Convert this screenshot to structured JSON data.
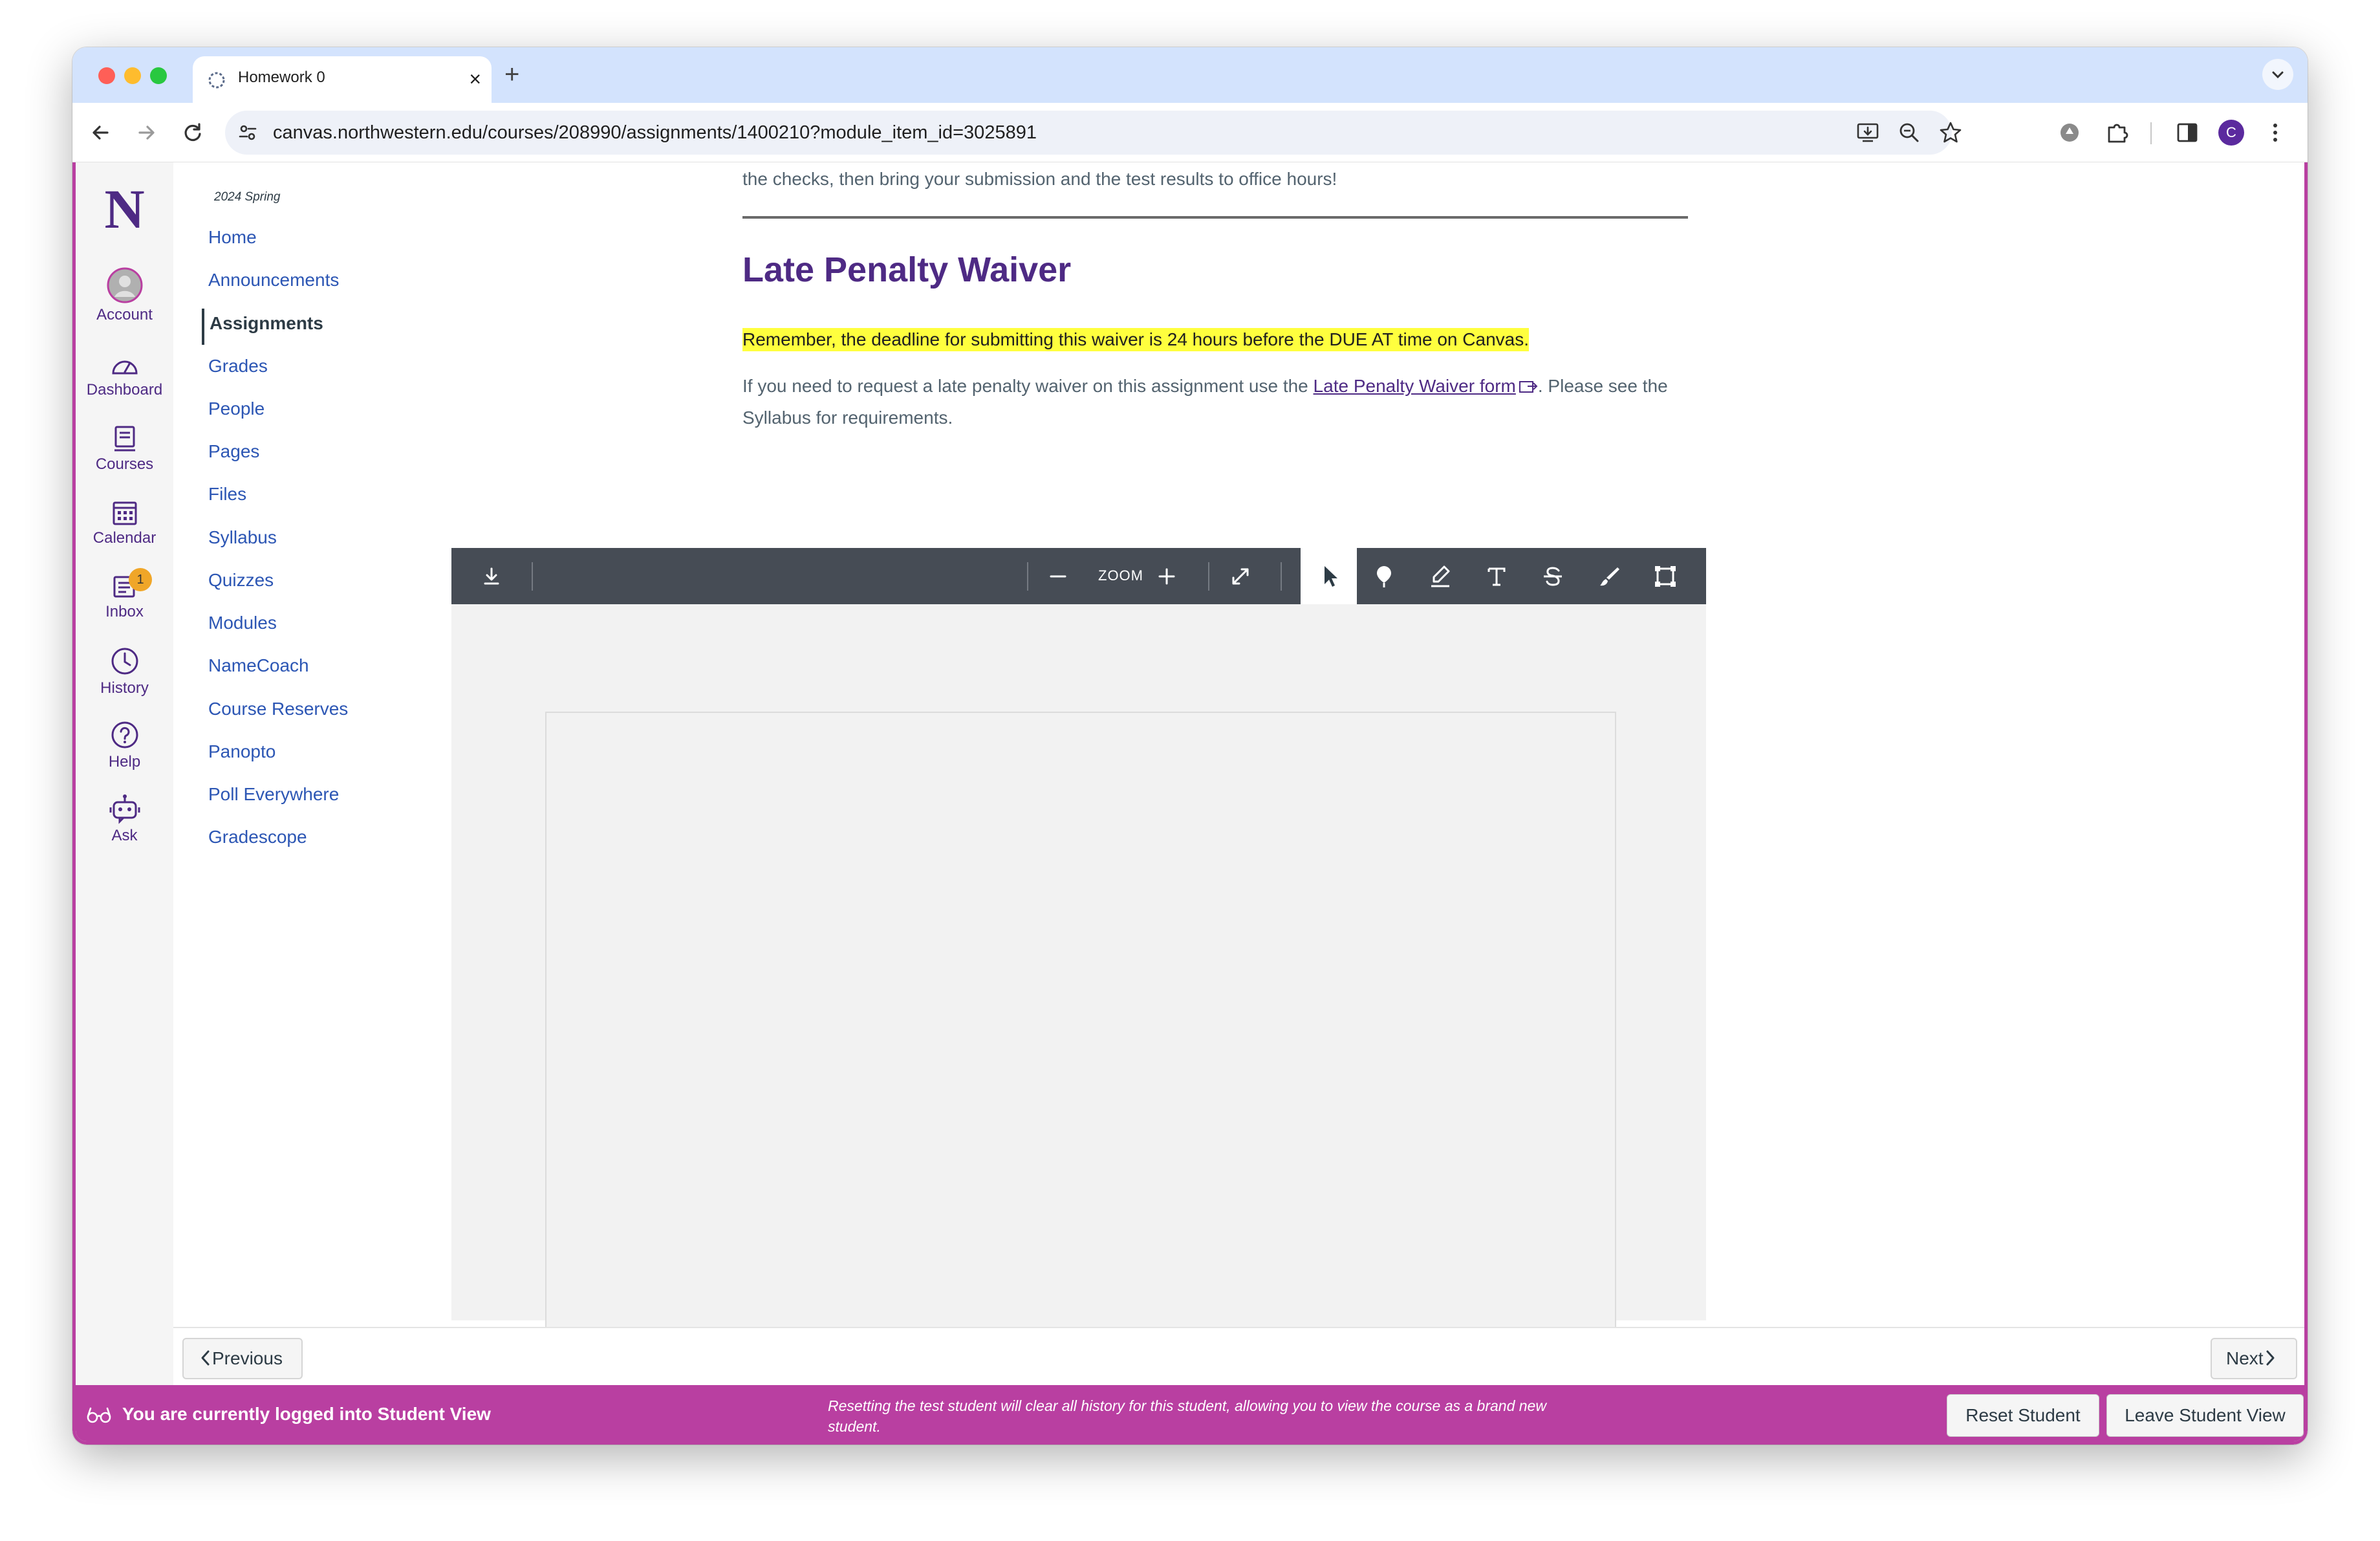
{
  "browser": {
    "tab_title": "Homework 0",
    "new_tab_symbol": "+",
    "close_symbol": "×",
    "url": "canvas.northwestern.edu/courses/208990/assignments/1400210?module_item_id=3025891",
    "profile_initial": "C"
  },
  "global_nav": {
    "logo": "N",
    "items": [
      {
        "label": "Account",
        "icon": "account-avatar-icon"
      },
      {
        "label": "Dashboard",
        "icon": "dashboard-icon"
      },
      {
        "label": "Courses",
        "icon": "courses-icon"
      },
      {
        "label": "Calendar",
        "icon": "calendar-icon"
      },
      {
        "label": "Inbox",
        "icon": "inbox-icon",
        "badge": "1"
      },
      {
        "label": "History",
        "icon": "history-icon"
      },
      {
        "label": "Help",
        "icon": "help-icon"
      },
      {
        "label": "Ask",
        "icon": "ask-bot-icon"
      }
    ]
  },
  "course_nav": {
    "term": "2024 Spring",
    "active": "Assignments",
    "items": [
      "Home",
      "Announcements",
      "Assignments",
      "Grades",
      "People",
      "Pages",
      "Files",
      "Syllabus",
      "Quizzes",
      "Modules",
      "NameCoach",
      "Course Reserves",
      "Panopto",
      "Poll Everywhere",
      "Gradescope"
    ]
  },
  "content": {
    "intro_fragment": "the checks, then bring your submission and the test results to office hours!",
    "heading": "Late Penalty Waiver",
    "highlight": "Remember, the deadline for submitting this waiver is 24 hours before the DUE AT time on Canvas.",
    "para_before": "If you need to request a late penalty waiver on this assignment use the ",
    "link_text": "Late Penalty Waiver form",
    "para_after": ". Please see the Syllabus for requirements."
  },
  "viewer": {
    "zoom_label": "ZOOM",
    "tools": [
      "download-icon",
      "zoom-out-icon",
      "zoom-in-icon",
      "fullscreen-icon",
      "select-pointer-icon",
      "point-annotation-icon",
      "highlight-pen-icon",
      "text-tool-icon",
      "strikeout-icon",
      "freedraw-icon",
      "area-select-icon"
    ],
    "active_tool": "select-pointer-icon"
  },
  "pager": {
    "previous": "Previous",
    "next": "Next"
  },
  "student_view": {
    "title": "You are currently logged into Student View",
    "note": "Resetting the test student will clear all history for this student, allowing you to view the course as a brand new student.",
    "reset_button": "Reset Student",
    "leave_button": "Leave Student View"
  },
  "colors": {
    "brand_purple": "#4e2a84",
    "student_view_magenta": "#b93fa1",
    "link_blue": "#2c56b4",
    "highlight_yellow": "#ffff3e",
    "viewer_toolbar": "#464c55"
  }
}
